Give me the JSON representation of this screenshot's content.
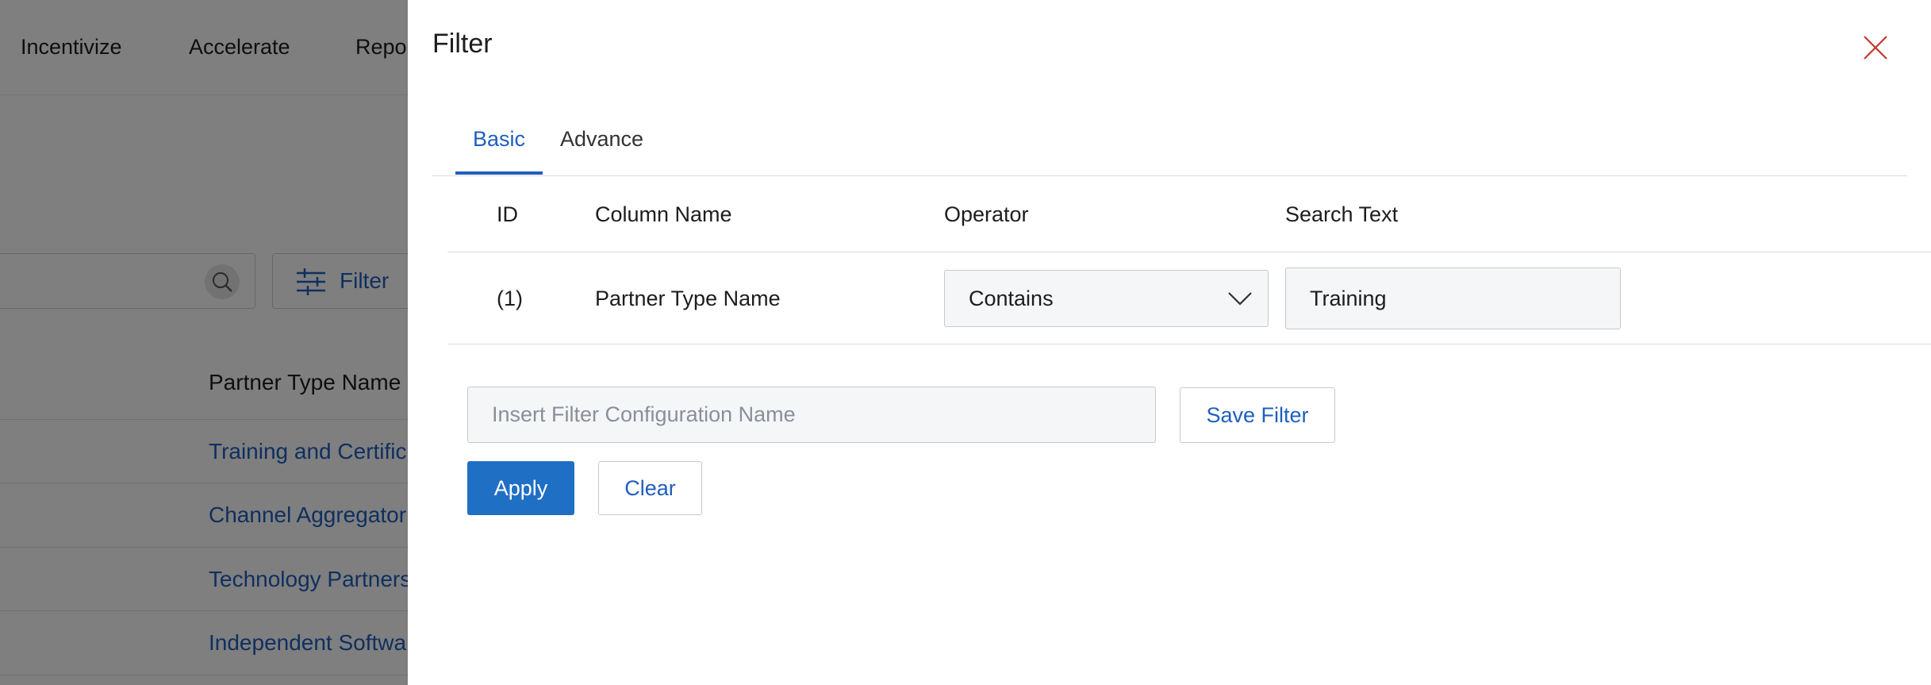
{
  "background": {
    "nav": [
      "Incentivize",
      "Accelerate",
      "Repor"
    ],
    "search_icon": "search-icon",
    "filter_button": {
      "icon": "sliders-icon",
      "label": "Filter"
    },
    "table": {
      "column_header": "Partner Type Name",
      "rows": [
        "Training and Certific",
        "Channel Aggregator",
        "Technology Partners",
        "Independent Softwa"
      ]
    }
  },
  "drawer": {
    "title": "Filter",
    "close_icon": "close-icon",
    "tabs": [
      {
        "label": "Basic",
        "active": true
      },
      {
        "label": "Advance",
        "active": false
      }
    ],
    "table": {
      "headers": {
        "id": "ID",
        "column_name": "Column Name",
        "operator": "Operator",
        "search_text": "Search Text"
      },
      "rows": [
        {
          "id": "(1)",
          "column_name": "Partner Type Name",
          "operator": "Contains",
          "search_text": "Training"
        }
      ]
    },
    "config_placeholder": "Insert Filter Configuration Name",
    "save_filter_label": "Save Filter",
    "apply_label": "Apply",
    "clear_label": "Clear"
  },
  "colors": {
    "accent": "#1f5fbf",
    "primary_button": "#1f6fc5",
    "close_icon": "#c0392b",
    "overlay": "#000000"
  }
}
